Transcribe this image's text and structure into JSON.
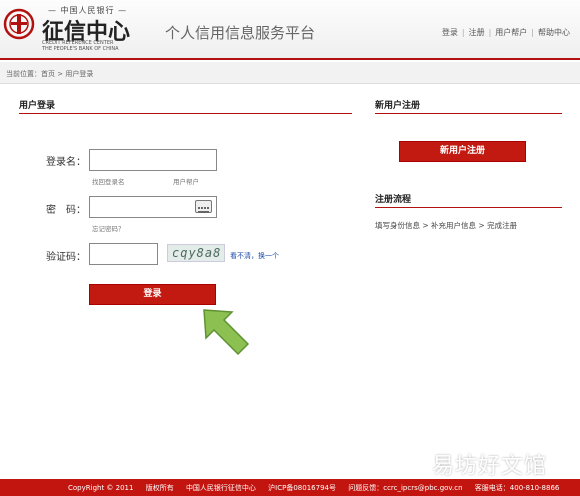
{
  "header": {
    "logo_top": "— 中国人民银行 —",
    "logo_main": "征信中心",
    "logo_sub_1": "CREDIT REFERENCE CENTER",
    "logo_sub_2": "THE PEOPLE'S BANK OF CHINA",
    "site_title": "个人信用信息服务平台",
    "links": [
      "登录",
      "注册",
      "用户帮户",
      "帮助中心"
    ]
  },
  "breadcrumb": "当前位置：首页 > 用户登录",
  "login": {
    "title": "用户登录",
    "username_label": "登录名：",
    "username_value": "",
    "find_username": "找回登录名",
    "user_wallet": "用户帮户",
    "password_label": "密　码：",
    "password_value": "",
    "forgot_password": "忘记密码？",
    "captcha_label": "验证码：",
    "captcha_value": "",
    "captcha_text": "cqy8a8",
    "captcha_refresh": "看不清，换一个",
    "submit": "登录"
  },
  "register": {
    "title": "新用户注册",
    "button": "新用户注册",
    "process_title": "注册流程",
    "process_steps": "填写身份信息 > 补充用户信息 > 完成注册"
  },
  "footer": {
    "copyright": "CopyRight © 2011",
    "rights": "版权所有",
    "org": "中国人民银行征信中心",
    "icp": "沪ICP备08016794号",
    "feedback": "问题反馈：ccrc_ipcrs@pbc.gov.cn",
    "phone": "客服电话：400-810-8866"
  },
  "watermark": "易坊好文馆",
  "colors": {
    "brand_red": "#c21a10",
    "arrow_green": "#8cc152"
  },
  "icons": [
    "seal-logo-icon",
    "keyboard-icon",
    "arrow-pointer-icon"
  ]
}
